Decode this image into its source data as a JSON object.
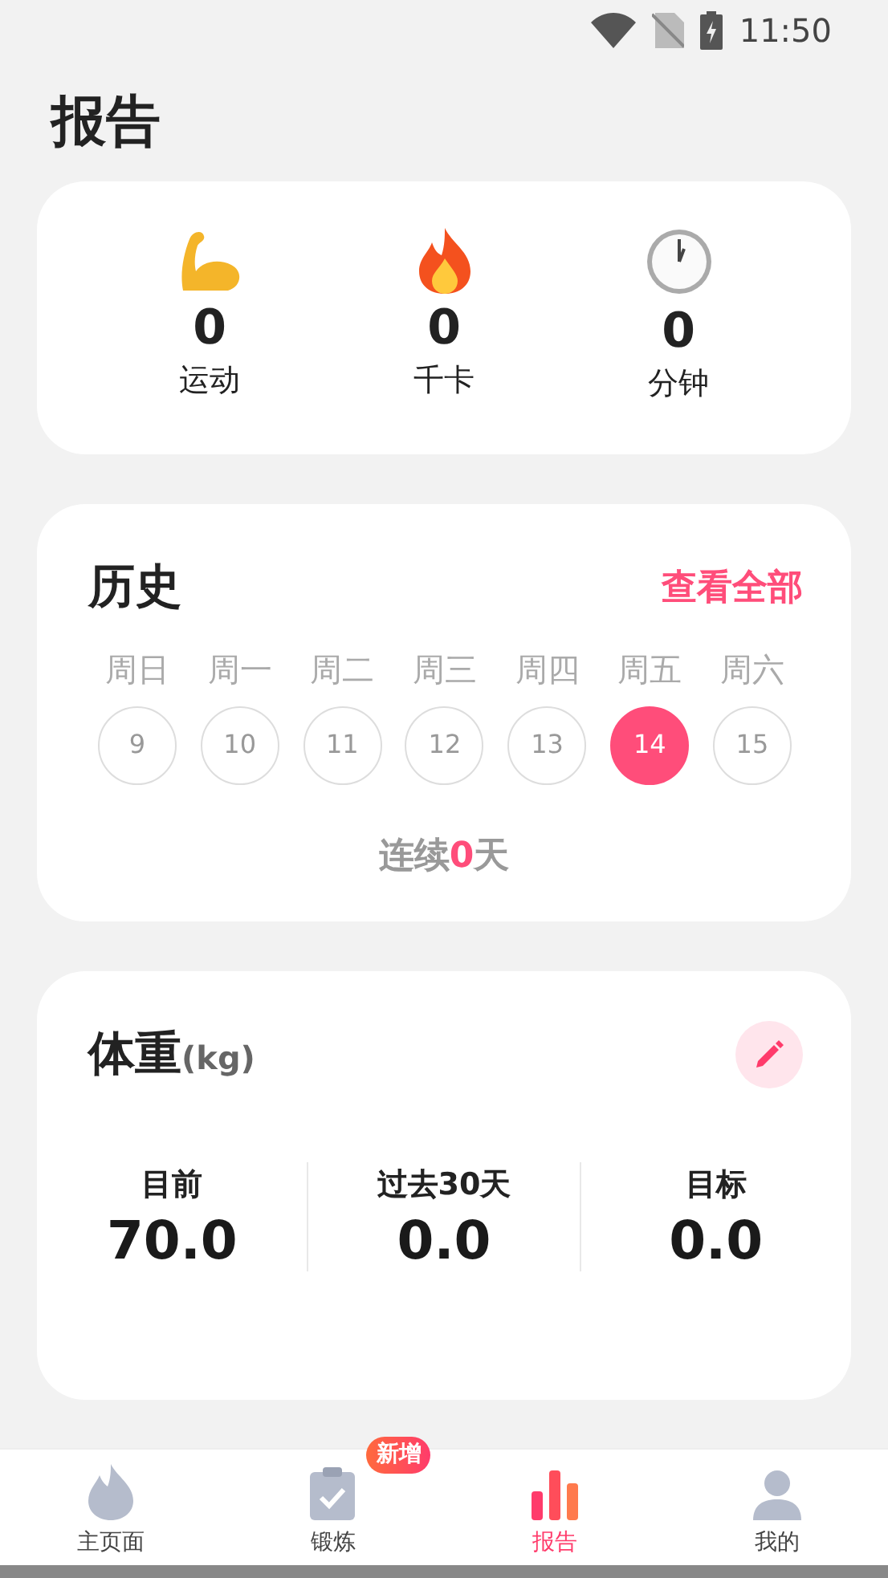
{
  "status_bar": {
    "time": "11:50"
  },
  "title": "报告",
  "summary": [
    {
      "kind": "muscle",
      "value": "0",
      "label": "运动"
    },
    {
      "kind": "fire",
      "value": "0",
      "label": "千卡"
    },
    {
      "kind": "clock",
      "value": "0",
      "label": "分钟"
    }
  ],
  "history": {
    "title": "历史",
    "link": "查看全部",
    "days": [
      {
        "weekday": "周日",
        "date": "9",
        "selected": false
      },
      {
        "weekday": "周一",
        "date": "10",
        "selected": false
      },
      {
        "weekday": "周二",
        "date": "11",
        "selected": false
      },
      {
        "weekday": "周三",
        "date": "12",
        "selected": false
      },
      {
        "weekday": "周四",
        "date": "13",
        "selected": false
      },
      {
        "weekday": "周五",
        "date": "14",
        "selected": true
      },
      {
        "weekday": "周六",
        "date": "15",
        "selected": false
      }
    ],
    "streak": {
      "prefix": "连续",
      "count": "0",
      "suffix": "天"
    }
  },
  "weight": {
    "title": "体重",
    "unit": "(kg)",
    "stats": [
      {
        "label": "目前",
        "value": "70.0"
      },
      {
        "label": "过去30天",
        "value": "0.0"
      },
      {
        "label": "目标",
        "value": "0.0"
      }
    ]
  },
  "tabs": [
    {
      "kind": "flame",
      "label": "主页面",
      "selected": false
    },
    {
      "kind": "clipboard",
      "label": "锻炼",
      "selected": false,
      "badge": "新增"
    },
    {
      "kind": "bars",
      "label": "报告",
      "selected": true
    },
    {
      "kind": "person",
      "label": "我的",
      "selected": false
    }
  ]
}
